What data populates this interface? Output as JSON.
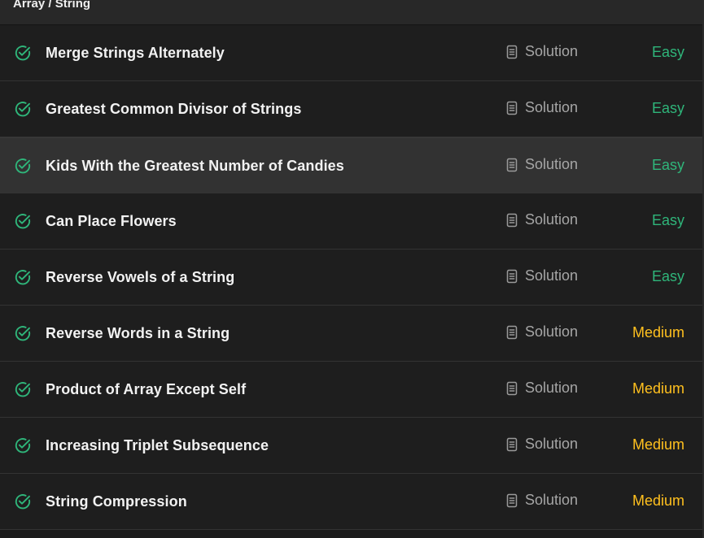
{
  "section": {
    "title": "Array / String"
  },
  "solution_label": "Solution",
  "colors": {
    "easy": "#2fb57a",
    "medium": "#ffc01e",
    "check": "#2fb57a"
  },
  "problems": [
    {
      "title": "Merge Strings Alternately",
      "difficulty": "Easy",
      "level": "easy",
      "status_icon": "check-circle-icon"
    },
    {
      "title": "Greatest Common Divisor of Strings",
      "difficulty": "Easy",
      "level": "easy",
      "status_icon": "check-circle-icon"
    },
    {
      "title": "Kids With the Greatest Number of Candies",
      "difficulty": "Easy",
      "level": "easy",
      "status_icon": "check-circle-icon",
      "hovered": true
    },
    {
      "title": "Can Place Flowers",
      "difficulty": "Easy",
      "level": "easy",
      "status_icon": "check-circle-icon"
    },
    {
      "title": "Reverse Vowels of a String",
      "difficulty": "Easy",
      "level": "easy",
      "status_icon": "check-circle-icon"
    },
    {
      "title": "Reverse Words in a String",
      "difficulty": "Medium",
      "level": "medium",
      "status_icon": "check-circle-icon"
    },
    {
      "title": "Product of Array Except Self",
      "difficulty": "Medium",
      "level": "medium",
      "status_icon": "check-circle-icon"
    },
    {
      "title": "Increasing Triplet Subsequence",
      "difficulty": "Medium",
      "level": "medium",
      "status_icon": "check-circle-icon"
    },
    {
      "title": "String Compression",
      "difficulty": "Medium",
      "level": "medium",
      "status_icon": "check-circle-icon"
    }
  ]
}
